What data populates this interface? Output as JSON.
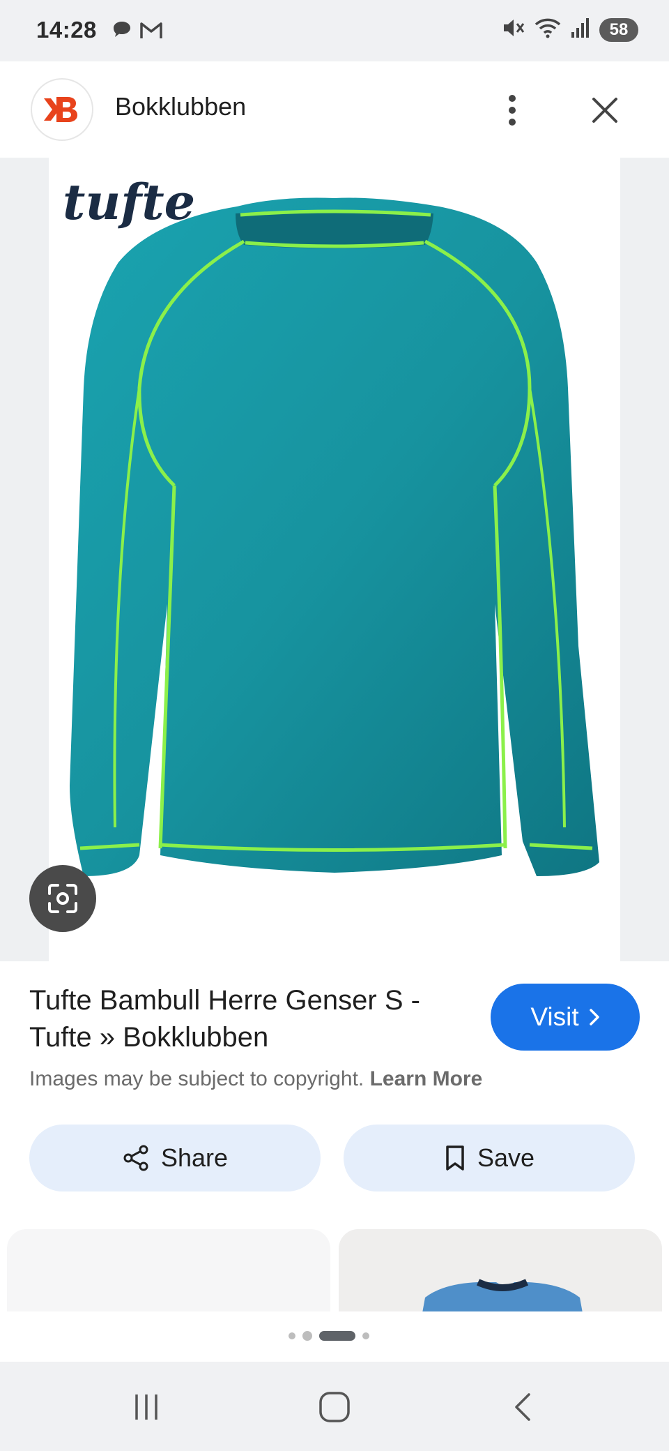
{
  "status_bar": {
    "time": "14:28",
    "left_icons": [
      "chat-bubble-icon",
      "gmail-icon"
    ],
    "right_icons": [
      "mute-icon",
      "wifi-icon",
      "signal-icon"
    ],
    "battery": "58"
  },
  "header": {
    "site_name": "Bokklubben",
    "logo_letter": "B",
    "logo_color": "#e8431c"
  },
  "image": {
    "brand_text": "tufte",
    "shirt_color": "#148f9c",
    "stitch_color": "#8bf04a"
  },
  "result": {
    "title": "Tufte Bambull Herre Genser S - Tufte » Bokklubben",
    "visit_label": "Visit",
    "copyright_text": "Images may be subject to copyright.",
    "learn_more": "Learn More"
  },
  "actions": {
    "share_label": "Share",
    "save_label": "Save"
  },
  "colors": {
    "accent": "#1a73e8",
    "action_bg": "#e5eefb"
  },
  "pager": {
    "dots": 4,
    "active_index": 2
  }
}
